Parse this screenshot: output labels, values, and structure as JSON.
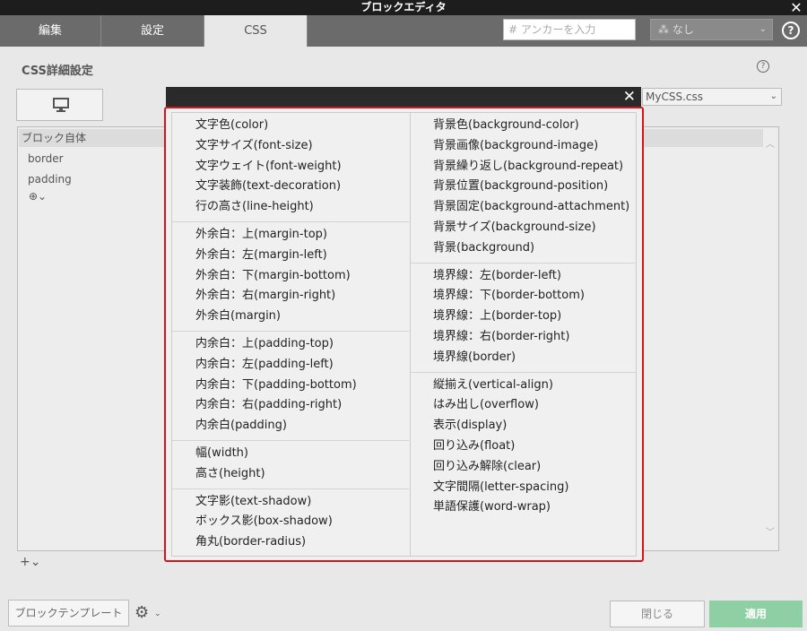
{
  "window": {
    "title": "ブロックエディタ"
  },
  "tabs": [
    {
      "label": "編集"
    },
    {
      "label": "設定"
    },
    {
      "label": "CSS"
    }
  ],
  "anchor": {
    "placeholder": "# アンカーを入力"
  },
  "select_none": {
    "value": "なし"
  },
  "section": {
    "title": "CSS詳細設定"
  },
  "css_file": {
    "value": "MyCSS.css"
  },
  "panel": {
    "header": "ブロック自体",
    "items": [
      "border",
      "padding"
    ]
  },
  "footer": {
    "template_label": "ブロックテンプレート",
    "close_label": "閉じる",
    "apply_label": "適用"
  },
  "popup": {
    "left_groups": [
      [
        "文字色(color)",
        "文字サイズ(font-size)",
        "文字ウェイト(font-weight)",
        "文字装飾(text-decoration)",
        "行の高さ(line-height)"
      ],
      [
        "外余白：上(margin-top)",
        "外余白：左(margin-left)",
        "外余白：下(margin-bottom)",
        "外余白：右(margin-right)",
        "外余白(margin)"
      ],
      [
        "内余白：上(padding-top)",
        "内余白：左(padding-left)",
        "内余白：下(padding-bottom)",
        "内余白：右(padding-right)",
        "内余白(padding)"
      ],
      [
        "幅(width)",
        "高さ(height)"
      ],
      [
        "文字影(text-shadow)",
        "ボックス影(box-shadow)",
        "角丸(border-radius)"
      ]
    ],
    "right_groups": [
      [
        "背景色(background-color)",
        "背景画像(background-image)",
        "背景繰り返し(background-repeat)",
        "背景位置(background-position)",
        "背景固定(background-attachment)",
        "背景サイズ(background-size)",
        "背景(background)"
      ],
      [
        "境界線：左(border-left)",
        "境界線：下(border-bottom)",
        "境界線：上(border-top)",
        "境界線：右(border-right)",
        "境界線(border)"
      ],
      [
        "縦揃え(vertical-align)",
        "はみ出し(overflow)",
        "表示(display)",
        "回り込み(float)",
        "回り込み解除(clear)",
        "文字間隔(letter-spacing)",
        "単語保護(word-wrap)"
      ]
    ]
  },
  "colors": {
    "accent_border": "#d4141c",
    "apply_bg": "#8ed0a3"
  },
  "icons": [
    "close-icon",
    "help-icon",
    "monitor-icon",
    "chevron-down-icon",
    "add-circle-icon",
    "plus-icon",
    "gear-icon",
    "tree-icon"
  ]
}
